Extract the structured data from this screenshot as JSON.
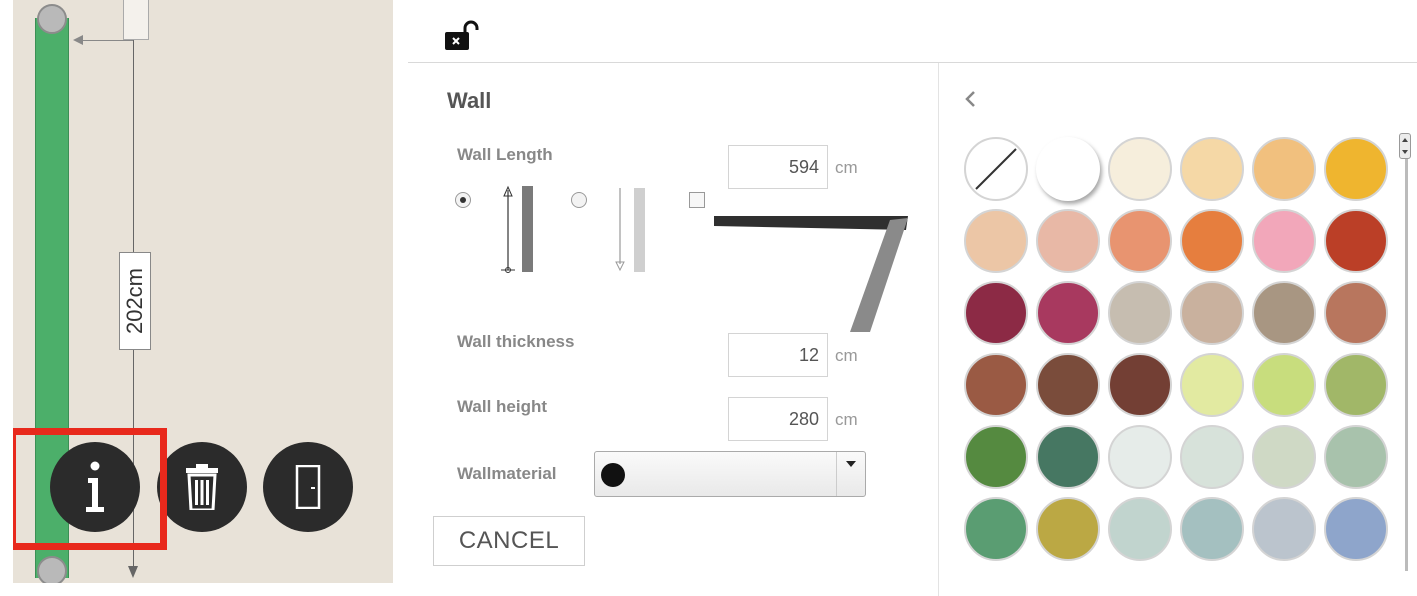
{
  "canvas": {
    "dimension_label": "202cm"
  },
  "panel": {
    "title": "Wall",
    "wall_length": {
      "label": "Wall Length",
      "value": "594",
      "unit": "cm"
    },
    "wall_thickness": {
      "label": "Wall thickness",
      "value": "12",
      "unit": "cm"
    },
    "wall_height": {
      "label": "Wall height",
      "value": "280",
      "unit": "cm"
    },
    "wall_material": {
      "label": "Wallmaterial",
      "selected_color": "#111111"
    },
    "cancel_label": "CANCEL",
    "length_mode_selected": 1
  },
  "icons": {
    "lock": "unlock-icon",
    "info": "info-icon",
    "delete": "trash-icon",
    "door": "door-icon",
    "back": "chevron-left-icon"
  },
  "colors": {
    "wall_green": "#4caf6a",
    "highlight": "#e8291c",
    "button_dark": "#2b2b2b"
  },
  "palette": [
    "none",
    "#ffffff",
    "#f6eedc",
    "#f5d8a6",
    "#f1c07e",
    "#efb52f",
    "#ecc6a6",
    "#e8b8a6",
    "#e89470",
    "#e67e3e",
    "#f2a7ba",
    "#bb3f27",
    "#8c2a45",
    "#a8395f",
    "#c6bdb0",
    "#c9b19e",
    "#a89682",
    "#b8765e",
    "#9a5a44",
    "#7a4c3b",
    "#733f34",
    "#e2eaa1",
    "#c8dd7d",
    "#a1b768",
    "#558a40",
    "#467762",
    "#e6ece9",
    "#d7e2da",
    "#cfd9c5",
    "#a8c2ac",
    "#5a9d72",
    "#bba844",
    "#c1d4ce",
    "#a4c0c0",
    "#bbc4cd",
    "#8ea5cb"
  ],
  "palette_selected_index": 1
}
